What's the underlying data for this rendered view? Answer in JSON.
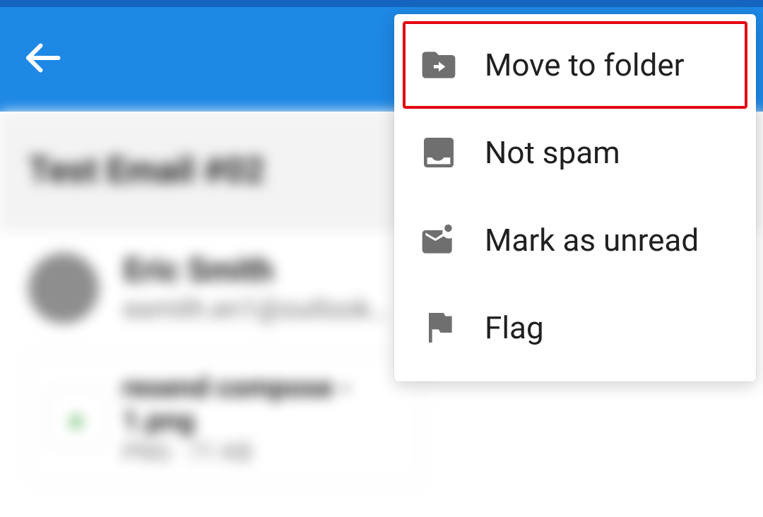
{
  "email": {
    "subject": "Test Email #02",
    "sender_name": "Eric Smith",
    "sender_email": "esmith.en1@outlook…",
    "attachment_name": "resend compose - 1.png",
    "attachment_meta": "PNG · 71 KB"
  },
  "menu": {
    "move_to_folder": "Move to folder",
    "not_spam": "Not spam",
    "mark_unread": "Mark as unread",
    "flag": "Flag"
  }
}
